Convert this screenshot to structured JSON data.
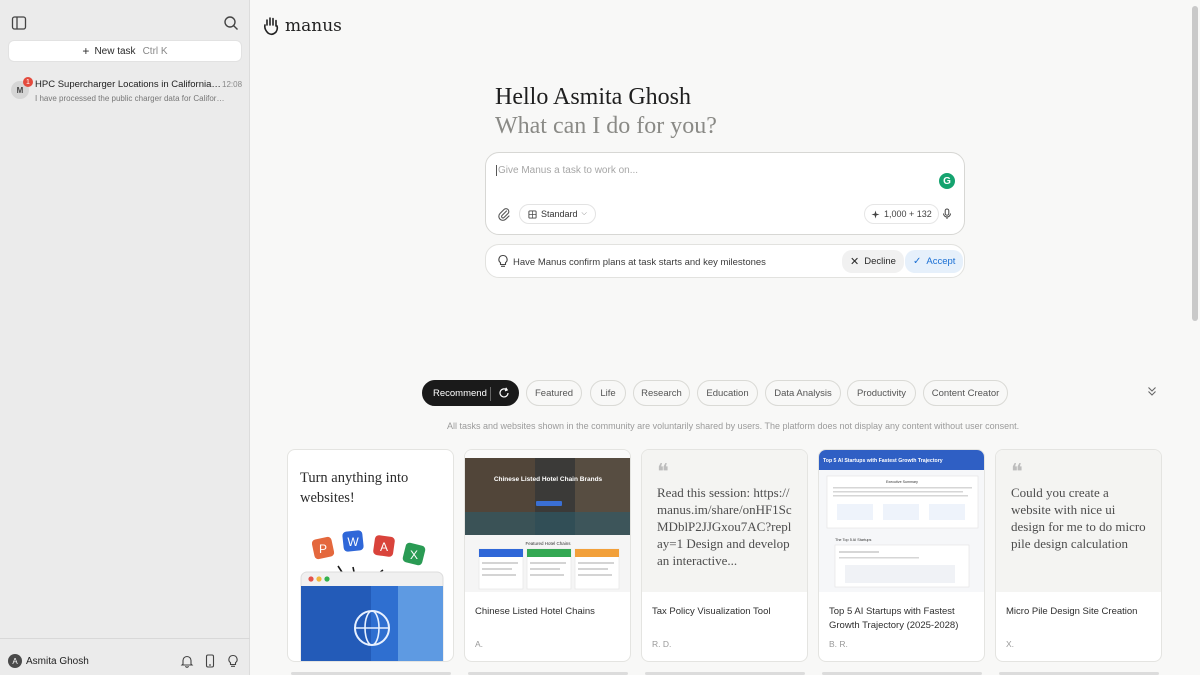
{
  "sidebar": {
    "new_task_label": "New task",
    "new_task_shortcut": "Ctrl  K",
    "tasks": [
      {
        "avatar": "M",
        "badge": "1",
        "title": "HPC Supercharger Locations in California Int...",
        "time": "12:08",
        "preview": "I have processed the public charger data for California..."
      }
    ],
    "user": {
      "initial": "A",
      "name": "Asmita Ghosh"
    }
  },
  "brand": {
    "name": "manus"
  },
  "hero": {
    "greeting": "Hello Asmita Ghosh",
    "prompt": "What can I do for you?"
  },
  "composer": {
    "placeholder": "Give Manus a task to work on...",
    "mode": "Standard",
    "credits": "1,000 + 132",
    "grammarly_icon": "G"
  },
  "confirm_bar": {
    "text": "Have Manus confirm plans at task starts and key milestones",
    "decline_label": "Decline",
    "accept_label": "Accept"
  },
  "tabs": [
    {
      "label": "Recommend",
      "active": true
    },
    {
      "label": "Featured"
    },
    {
      "label": "Life"
    },
    {
      "label": "Research"
    },
    {
      "label": "Education"
    },
    {
      "label": "Data Analysis"
    },
    {
      "label": "Productivity"
    },
    {
      "label": "Content Creator"
    }
  ],
  "notice": "All tasks and websites shown in the community are voluntarily shared by users. The platform does not display any content without user consent.",
  "cards": [
    {
      "type": "promo",
      "headline": "Turn anything into websites!",
      "app_letters": [
        "P",
        "W",
        "A",
        "X"
      ]
    },
    {
      "type": "thumb",
      "thumb_heading": "Chinese Listed Hotel Chain Brands",
      "thumb_sub": "Featured Hotel Chains",
      "title": "Chinese Listed Hotel Chains",
      "author": "A."
    },
    {
      "type": "quote",
      "quote": "Read this session: https://manus.im/share/onHF1ScMDblP2JJGxou7AC?replay=1 Design and develop an interactive...",
      "title": "Tax Policy Visualization Tool",
      "author": "R. D."
    },
    {
      "type": "thumb2",
      "thumb_heading": "Top 5 AI Startups with Fastest Growth Trajectory",
      "thumb_sub": "Executive Summary",
      "thumb_section": "The Top 5 AI Startups",
      "title": "Top 5 AI Startups with Fastest Growth Trajectory (2025-2028)",
      "author": "B. R."
    },
    {
      "type": "quote",
      "quote": "Could you create a website with nice ui design for me to do micro pile design calculation",
      "title": "Micro Pile Design Site Creation",
      "author": "X."
    }
  ],
  "colors": {
    "accent": "#1a6fd4",
    "active_tab": "#1a1a1a",
    "badge": "#e34a3d",
    "grammarly": "#15a36f"
  }
}
